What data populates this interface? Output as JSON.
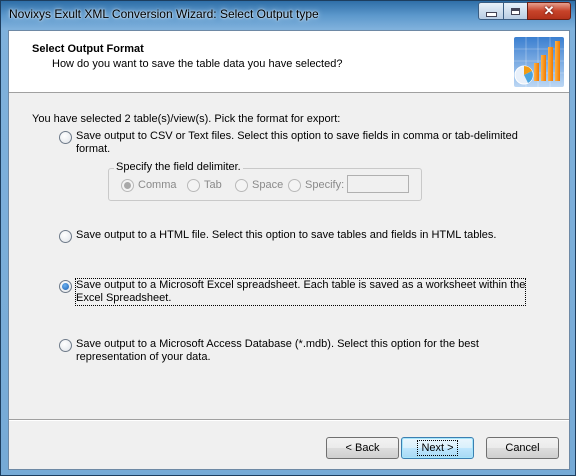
{
  "window": {
    "title": "Novixys Exult XML Conversion Wizard: Select Output type"
  },
  "header": {
    "title": "Select Output Format",
    "subtitle": "How do you want to save the table data you have selected?",
    "logo_icon": "excel-chart-logo-icon"
  },
  "intro": "You have selected 2 table(s)/view(s). Pick the format for export:",
  "options": [
    {
      "label_line1": "Save output to CSV or Text files. Select this option to save fields in comma or tab-delimited",
      "label_line2": "format.",
      "checked": false
    },
    {
      "label_line1": "Save output to a HTML file. Select this option to save tables and fields in HTML tables.",
      "label_line2": "",
      "checked": false
    },
    {
      "label_line1": "Save output to a Microsoft Excel spreadsheet. Each table is saved as a worksheet within the",
      "label_line2": "Excel Spreadsheet.",
      "checked": true
    },
    {
      "label_line1": "Save output to a Microsoft Access Database (*.mdb). Select this option for the best",
      "label_line2": "representation of your data.",
      "checked": false
    }
  ],
  "delimiter": {
    "caption": "Specify the field delimiter.",
    "choices": [
      "Comma",
      "Tab",
      "Space",
      "Specify:"
    ],
    "selected": "Comma",
    "specify_value": ""
  },
  "buttons": {
    "back": "< Back",
    "next": "Next >",
    "cancel": "Cancel"
  },
  "colors": {
    "accent": "#3c7fb1",
    "titlebar": "#5b97cb",
    "close": "#c7432a"
  }
}
